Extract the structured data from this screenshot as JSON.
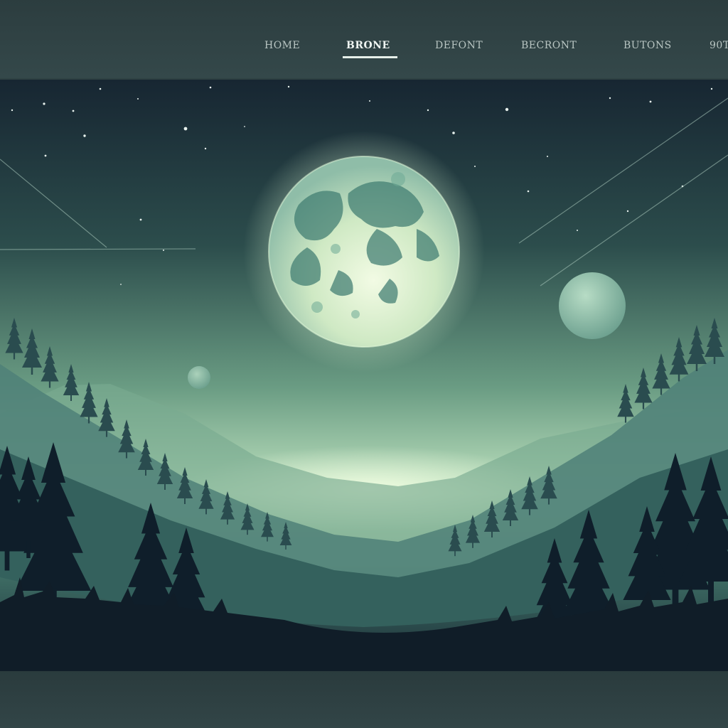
{
  "nav": {
    "items": [
      {
        "label": "HOME",
        "active": false
      },
      {
        "label": "BRONE",
        "active": true
      },
      {
        "label": "DEFONT",
        "active": false
      },
      {
        "label": "BECRONT",
        "active": false
      },
      {
        "label": "BUTONS",
        "active": false
      },
      {
        "label": "90T",
        "active": false
      }
    ]
  },
  "hero": {
    "image": "moonlit-valley-with-pine-forest",
    "colors": {
      "sky_top": "#172632",
      "sky_bottom": "#bfe3c0",
      "moon": "#dff3d3",
      "forest": "#0f1e2a"
    }
  }
}
